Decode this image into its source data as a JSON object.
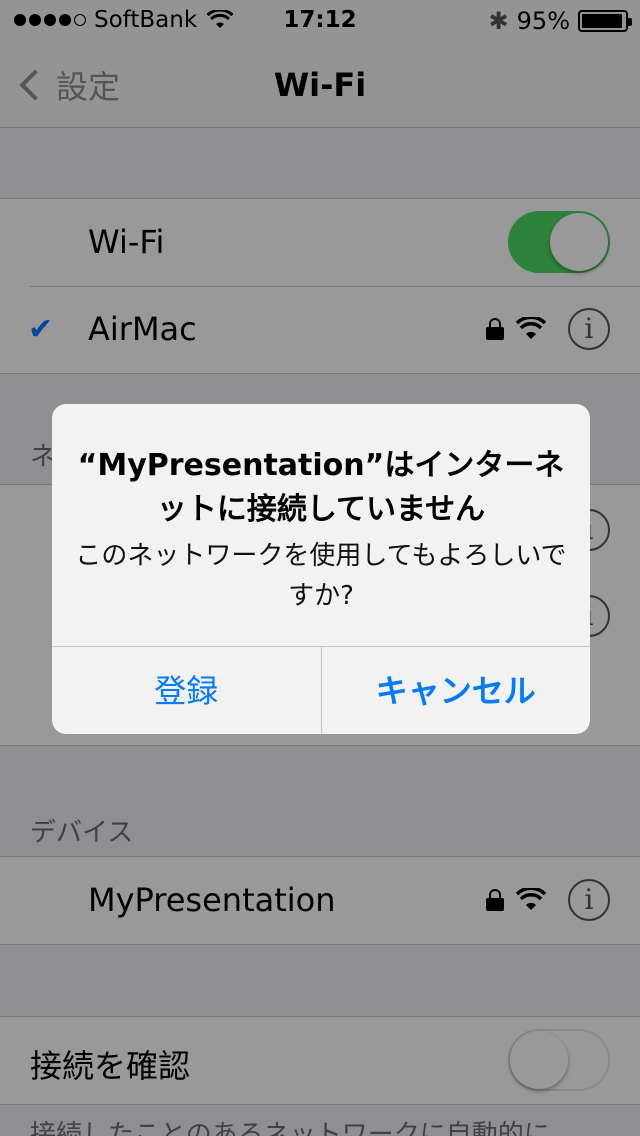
{
  "status_bar": {
    "signal_dots_filled": 4,
    "signal_dots_total": 5,
    "carrier": "SoftBank",
    "time": "17:12",
    "battery_text": "95%",
    "battery_level": 0.95
  },
  "nav": {
    "back_label": "設定",
    "title": "Wi-Fi"
  },
  "wifi_group": {
    "toggle_label": "Wi-Fi",
    "toggle_on": true,
    "connected_network": "AirMac"
  },
  "networks_section": {
    "header_partial": "ネ"
  },
  "devices_section": {
    "header": "デバイス",
    "device_name": "MyPresentation"
  },
  "ask_join": {
    "label": "接続を確認",
    "toggle_on": false,
    "footer_partial": "接続したことのあるネットワークに自動的に"
  },
  "alert": {
    "title": "“MyPresentation”はインターネットに接続していません",
    "message": "このネットワークを使用してもよろしいですか?",
    "buttons": [
      "登録",
      "キャンセル"
    ]
  },
  "colors": {
    "accent": "#007aff",
    "switch_on": "#4cd964"
  }
}
